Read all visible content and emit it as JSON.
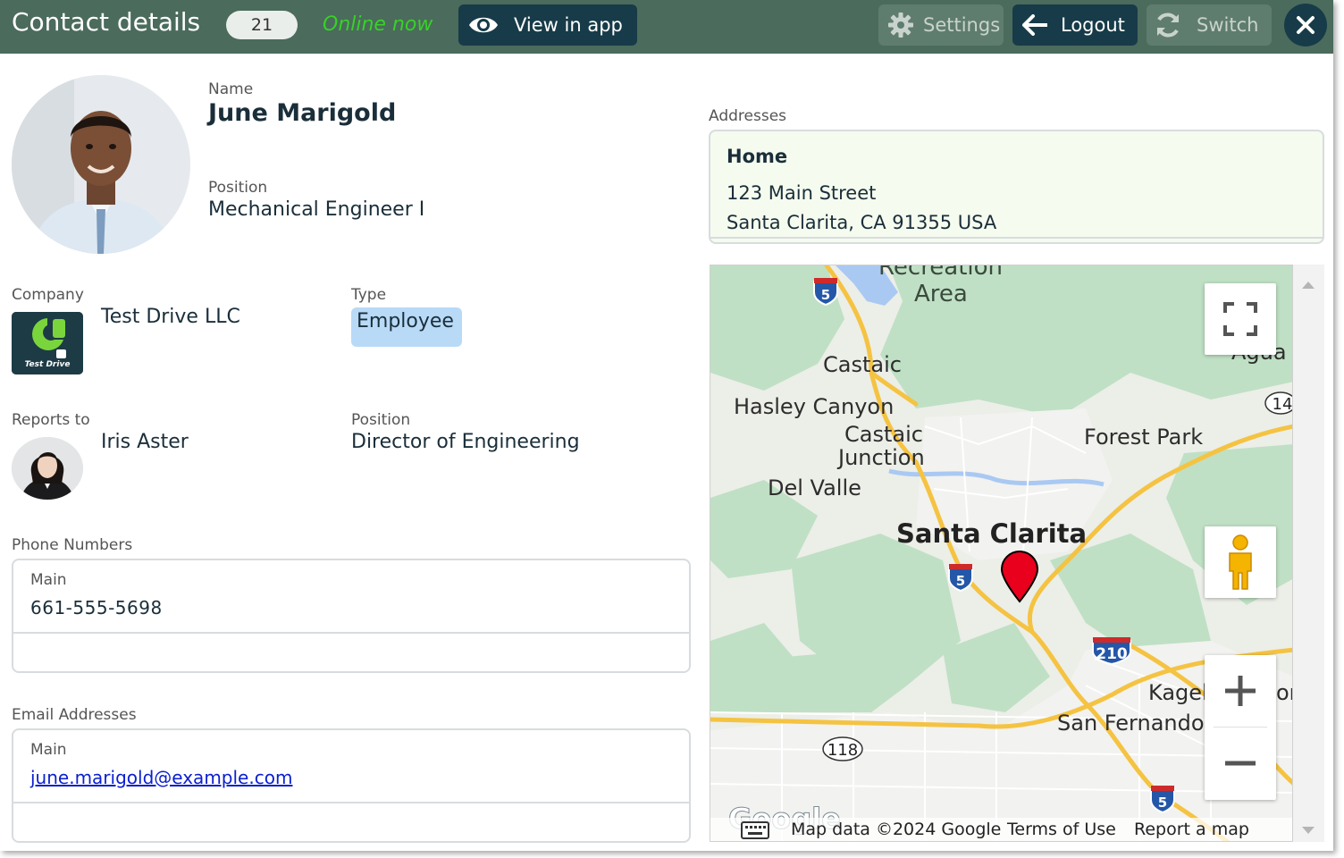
{
  "header": {
    "title": "Contact details",
    "count": "21",
    "status": "Online now",
    "view_label": "View in app",
    "settings_label": "Settings",
    "logout_label": "Logout",
    "switch_label": "Switch"
  },
  "contact": {
    "name_label": "Name",
    "name": "June Marigold",
    "position_label": "Position",
    "position": "Mechanical Engineer I",
    "company_label": "Company",
    "company": "Test Drive LLC",
    "company_logo_text": "Test Drive",
    "type_label": "Type",
    "type": "Employee",
    "reports_label": "Reports to",
    "reports_to": "Iris Aster",
    "reports_position_label": "Position",
    "reports_position": "Director of Engineering"
  },
  "phones": {
    "section_label": "Phone Numbers",
    "items": [
      {
        "label": "Main",
        "value": "661-555-5698"
      }
    ]
  },
  "emails": {
    "section_label": "Email Addresses",
    "items": [
      {
        "label": "Main",
        "value": "june.marigold@example.com"
      }
    ]
  },
  "addresses": {
    "section_label": "Addresses",
    "items": [
      {
        "title": "Home",
        "line1": "123 Main Street",
        "line2": "Santa Clarita, CA 91355 USA"
      }
    ]
  },
  "map": {
    "places": [
      "Recreation",
      "Area",
      "Castaic",
      "Hasley Canyon",
      "Castaic",
      "Junction",
      "Del Valle",
      "Santa Clarita",
      "Forest Park",
      "Kagel",
      "San Fernando",
      "Agua",
      "on"
    ],
    "shields": [
      "5",
      "5",
      "5",
      "14",
      "210",
      "118"
    ],
    "logo": "Google",
    "footer": {
      "data": "Map data ©2024 Google",
      "terms": "Terms of Use",
      "report": "Report a map error"
    }
  },
  "colors": {
    "header_bg": "#4b6b5c",
    "dark_button": "#173b48",
    "online": "#37d227",
    "type_badge": "#b8daf7",
    "address_bg": "#f5fbee",
    "marker": "#e8001c"
  }
}
